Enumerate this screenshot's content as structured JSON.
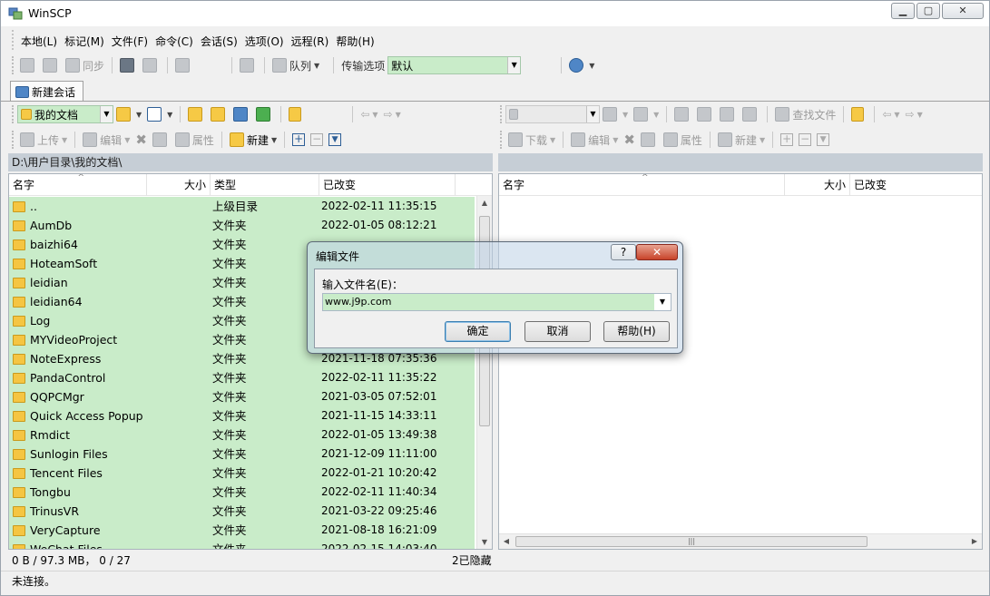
{
  "window": {
    "title": "WinSCP"
  },
  "menu": [
    "本地(L)",
    "标记(M)",
    "文件(F)",
    "命令(C)",
    "会话(S)",
    "选项(O)",
    "远程(R)",
    "帮助(H)"
  ],
  "toolbar_main": {
    "sync": "同步",
    "queue": "队列",
    "transfer_label": "传输选项",
    "transfer_value": "默认"
  },
  "session_tab": "新建会话",
  "left_toolbar": {
    "location": "我的文档",
    "upload": "上传",
    "edit": "编辑",
    "properties": "属性",
    "new": "新建"
  },
  "right_toolbar": {
    "find": "查找文件",
    "download": "下载",
    "edit": "编辑",
    "properties": "属性",
    "new": "新建"
  },
  "left_panel": {
    "path": "D:\\用户目录\\我的文档\\",
    "columns": [
      "名字",
      "大小",
      "类型",
      "已改变"
    ],
    "rows": [
      {
        "name": "..",
        "type": "上级目录",
        "date": "2022-02-11  11:35:15",
        "parent": true
      },
      {
        "name": "AumDb",
        "type": "文件夹",
        "date": "2022-01-05  08:12:21"
      },
      {
        "name": "baizhi64",
        "type": "文件夹",
        "date": ""
      },
      {
        "name": "HoteamSoft",
        "type": "文件夹",
        "date": ""
      },
      {
        "name": "leidian",
        "type": "文件夹",
        "date": ""
      },
      {
        "name": "leidian64",
        "type": "文件夹",
        "date": ""
      },
      {
        "name": "Log",
        "type": "文件夹",
        "date": ""
      },
      {
        "name": "MYVideoProject",
        "type": "文件夹",
        "date": ""
      },
      {
        "name": "NoteExpress",
        "type": "文件夹",
        "date": "2021-11-18  07:35:36"
      },
      {
        "name": "PandaControl",
        "type": "文件夹",
        "date": "2022-02-11  11:35:22"
      },
      {
        "name": "QQPCMgr",
        "type": "文件夹",
        "date": "2021-03-05  07:52:01"
      },
      {
        "name": "Quick Access Popup",
        "type": "文件夹",
        "date": "2021-11-15  14:33:11"
      },
      {
        "name": "Rmdict",
        "type": "文件夹",
        "date": "2022-01-05  13:49:38"
      },
      {
        "name": "Sunlogin Files",
        "type": "文件夹",
        "date": "2021-12-09  11:11:00"
      },
      {
        "name": "Tencent Files",
        "type": "文件夹",
        "date": "2022-01-21  10:20:42"
      },
      {
        "name": "Tongbu",
        "type": "文件夹",
        "date": "2022-02-11  11:40:34"
      },
      {
        "name": "TrinusVR",
        "type": "文件夹",
        "date": "2021-03-22  09:25:46"
      },
      {
        "name": "VeryCapture",
        "type": "文件夹",
        "date": "2021-08-18  16:21:09"
      },
      {
        "name": "WeChat Files",
        "type": "文件夹",
        "date": "2022-02-15  14:03:40"
      }
    ]
  },
  "right_panel": {
    "columns": [
      "名字",
      "大小",
      "已改变"
    ]
  },
  "status": {
    "left": "0 B / 97.3 MB，  0 / 27",
    "hidden": "2已隐藏",
    "connection": "未连接。"
  },
  "dialog": {
    "title": "编辑文件",
    "help_glyph": "?",
    "close_glyph": "✕",
    "label": "输入文件名(E)：",
    "value": "www.j9p.com",
    "ok": "确定",
    "cancel": "取消",
    "help": "帮助(H)"
  }
}
